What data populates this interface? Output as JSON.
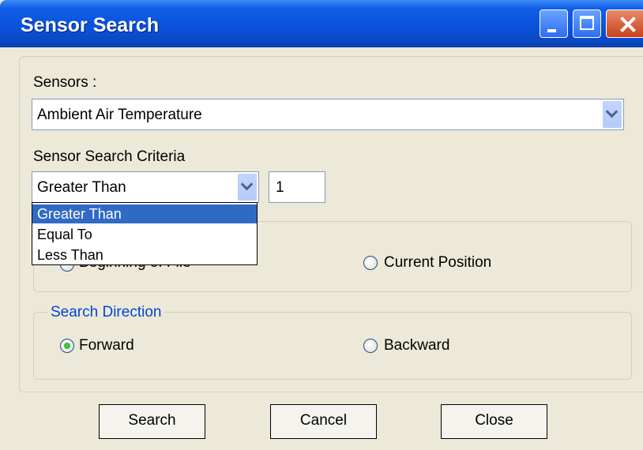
{
  "window": {
    "title": "Sensor Search"
  },
  "sensors": {
    "label": "Sensors :",
    "selected": "Ambient Air Temperature"
  },
  "criteria": {
    "label": "Sensor Search Criteria",
    "selected": "Greater Than",
    "value": "1",
    "options": [
      "Greater Than",
      "Equal To",
      "Less Than"
    ]
  },
  "search_from": {
    "option_beginning": "Beginning of File",
    "option_current": "Current Position"
  },
  "search_direction": {
    "label": "Search Direction",
    "option_forward": "Forward",
    "option_backward": "Backward",
    "selected": "Forward"
  },
  "buttons": {
    "search": "Search",
    "cancel": "Cancel",
    "close": "Close"
  }
}
